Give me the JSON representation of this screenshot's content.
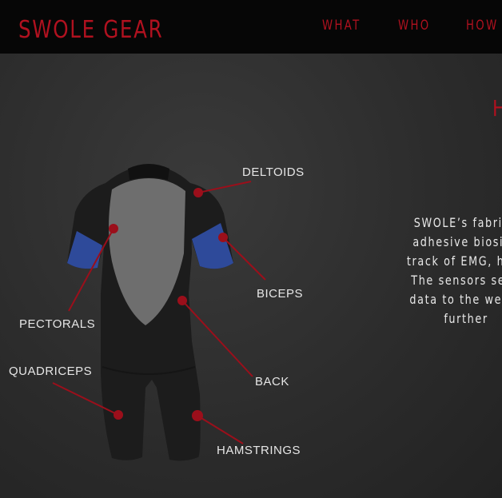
{
  "header": {
    "logo": "SWOLE GEAR",
    "nav": [
      {
        "label": "WHAT"
      },
      {
        "label": "WHO"
      },
      {
        "label": "HOW"
      }
    ]
  },
  "hero": {
    "heading_fragment": "H",
    "description_lines": [
      "SWOLE’s fabric i",
      "adhesive biosign",
      "track of EMG, hear",
      "The sensors send",
      "data to the weare",
      "further"
    ],
    "muscle_labels": {
      "deltoids": "DELTOIDS",
      "biceps": "BICEPS",
      "pectorals": "PECTORALS",
      "quadriceps": "QUADRICEPS",
      "back": "BACK",
      "hamstrings": "HAMSTRINGS"
    }
  },
  "colors": {
    "accent": "#b0111f",
    "header_bg": "#060606",
    "suit_black": "#1c1c1c",
    "suit_gray": "#6e6e6e",
    "suit_blue": "#2e4a9a"
  }
}
